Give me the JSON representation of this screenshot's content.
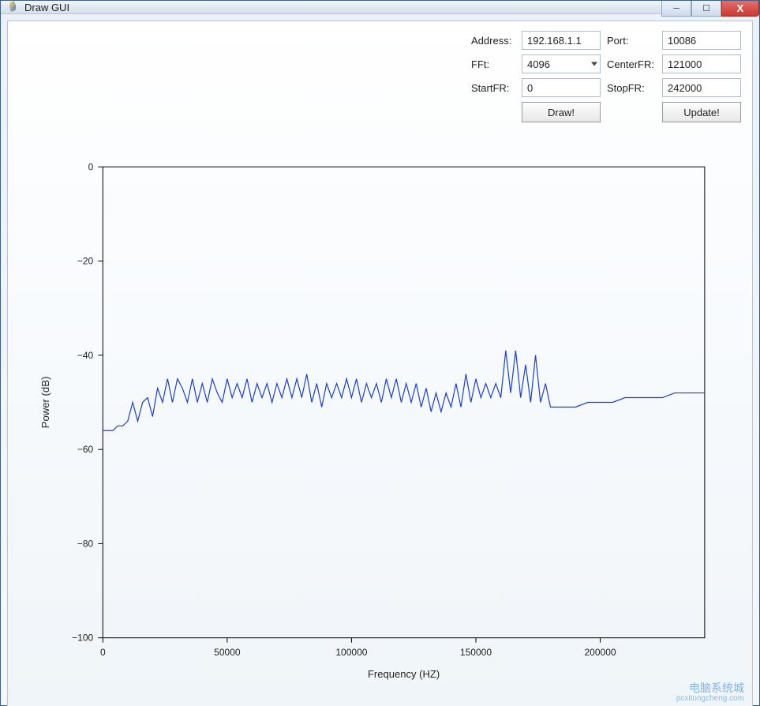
{
  "window": {
    "title": "Draw GUI"
  },
  "controls": {
    "address_label": "Address:",
    "address_value": "192.168.1.1",
    "port_label": "Port:",
    "port_value": "10086",
    "fft_label": "FFt:",
    "fft_value": "4096",
    "centerfr_label": "CenterFR:",
    "centerfr_value": "121000",
    "startfr_label": "StartFR:",
    "startfr_value": "0",
    "stopfr_label": "StopFR:",
    "stopfr_value": "242000",
    "draw_button": "Draw!",
    "update_button": "Update!"
  },
  "watermark": {
    "line1": "电脑系统城",
    "line2": "pcxitongcheng.com"
  },
  "chart_data": {
    "type": "line",
    "xlabel": "Frequency (HZ)",
    "ylabel": "Power (dB)",
    "xlim": [
      0,
      242000
    ],
    "ylim": [
      -100,
      0
    ],
    "xticks": [
      0,
      50000,
      100000,
      150000,
      200000
    ],
    "yticks": [
      -100,
      -80,
      -60,
      -40,
      -20,
      0
    ],
    "series": [
      {
        "name": "Power",
        "color": "#1a3fd4",
        "x": [
          0,
          2000,
          4000,
          6000,
          8000,
          10000,
          12000,
          14000,
          16000,
          18000,
          20000,
          22000,
          24000,
          26000,
          28000,
          30000,
          32000,
          34000,
          36000,
          38000,
          40000,
          42000,
          44000,
          46000,
          48000,
          50000,
          52000,
          54000,
          56000,
          58000,
          60000,
          62000,
          64000,
          66000,
          68000,
          70000,
          72000,
          74000,
          76000,
          78000,
          80000,
          82000,
          84000,
          86000,
          88000,
          90000,
          92000,
          94000,
          96000,
          98000,
          100000,
          102000,
          104000,
          106000,
          108000,
          110000,
          112000,
          114000,
          116000,
          118000,
          120000,
          122000,
          124000,
          126000,
          128000,
          130000,
          132000,
          134000,
          136000,
          138000,
          140000,
          142000,
          144000,
          146000,
          148000,
          150000,
          152000,
          154000,
          156000,
          158000,
          160000,
          162000,
          164000,
          166000,
          168000,
          170000,
          172000,
          174000,
          176000,
          178000,
          180000,
          185000,
          190000,
          195000,
          200000,
          205000,
          210000,
          215000,
          220000,
          225000,
          230000,
          235000,
          240000,
          242000
        ],
        "y": [
          -56,
          -56,
          -56,
          -55,
          -55,
          -54,
          -50,
          -54,
          -50,
          -49,
          -53,
          -47,
          -50,
          -45,
          -50,
          -45,
          -47,
          -50,
          -45,
          -50,
          -46,
          -50,
          -45,
          -48,
          -50,
          -45,
          -49,
          -46,
          -49,
          -45,
          -50,
          -46,
          -49,
          -46,
          -50,
          -46,
          -49,
          -45,
          -49,
          -45,
          -49,
          -44,
          -50,
          -46,
          -51,
          -46,
          -49,
          -46,
          -49,
          -45,
          -49,
          -45,
          -50,
          -46,
          -49,
          -46,
          -50,
          -45,
          -49,
          -45,
          -50,
          -46,
          -50,
          -46,
          -51,
          -47,
          -52,
          -48,
          -52,
          -48,
          -51,
          -46,
          -51,
          -44,
          -50,
          -45,
          -49,
          -46,
          -49,
          -46,
          -49,
          -39,
          -48,
          -39,
          -49,
          -42,
          -50,
          -40,
          -50,
          -46,
          -51,
          -51,
          -51,
          -50,
          -50,
          -50,
          -49,
          -49,
          -49,
          -49,
          -48,
          -48,
          -48,
          -48
        ]
      }
    ]
  }
}
